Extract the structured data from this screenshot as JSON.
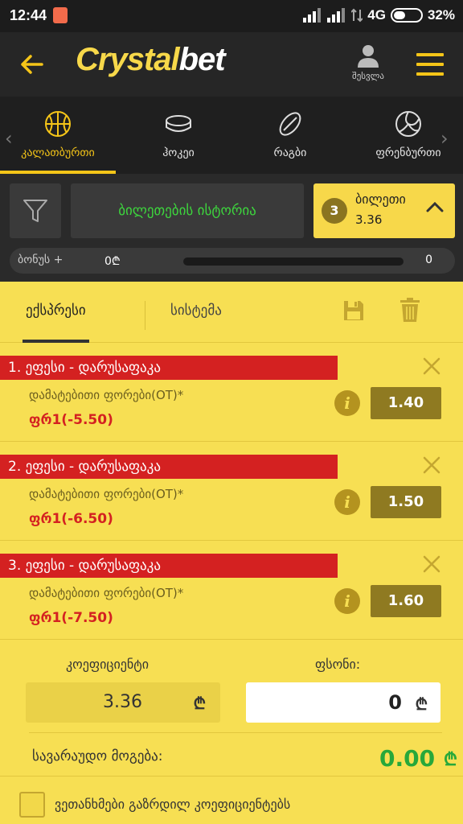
{
  "status_bar": {
    "time": "12:44",
    "network": "4G",
    "battery": "32%"
  },
  "header": {
    "logo_part1": "Crystal",
    "logo_part2": "bet",
    "user_label": "შესვლა"
  },
  "sports": [
    {
      "label": "კალათბურთი",
      "icon": "basketball-icon",
      "active": true
    },
    {
      "label": "ჰოკეი",
      "icon": "hockey-puck-icon",
      "active": false
    },
    {
      "label": "რაგბი",
      "icon": "rugby-ball-icon",
      "active": false
    },
    {
      "label": "ფრენბურთი",
      "icon": "volleyball-icon",
      "active": false
    }
  ],
  "toolbar": {
    "history_label": "ბილეთების ისტორია",
    "ticket_count": "3",
    "ticket_label": "ბილეთი",
    "ticket_odds": "3.36"
  },
  "bonus": {
    "label": "ბონუს +",
    "amount": "0₾",
    "max": "0",
    "progress": 0
  },
  "slip": {
    "tab_express": "ექსპრესი",
    "tab_system": "სისტემა",
    "bets": [
      {
        "index": "1.",
        "match": "ეფესი - დარუსაფაკა",
        "market": "დამატებითი ფორები(OT)*",
        "pick": "ფრ1(-5.50)",
        "odds": "1.40"
      },
      {
        "index": "2.",
        "match": "ეფესი - დარუსაფაკა",
        "market": "დამატებითი ფორები(OT)*",
        "pick": "ფრ1(-6.50)",
        "odds": "1.50"
      },
      {
        "index": "3.",
        "match": "ეფესი - დარუსაფაკა",
        "market": "დამატებითი ფორები(OT)*",
        "pick": "ფრ1(-7.50)",
        "odds": "1.60"
      }
    ]
  },
  "summary": {
    "coef_label": "კოეფიციენტი",
    "coef_value": "3.36",
    "stake_label": "ფსონი:",
    "stake_value": "0",
    "currency": "₾",
    "win_label": "სავარაუდო მოგება:",
    "win_value": "0.00",
    "agree_text": "ვეთანხმები გაზრდილ კოეფიციენტებს"
  },
  "colors": {
    "accent": "#f5c518",
    "panel": "#f7df53",
    "bet_red": "#d42121",
    "win_green": "#27a83a"
  }
}
